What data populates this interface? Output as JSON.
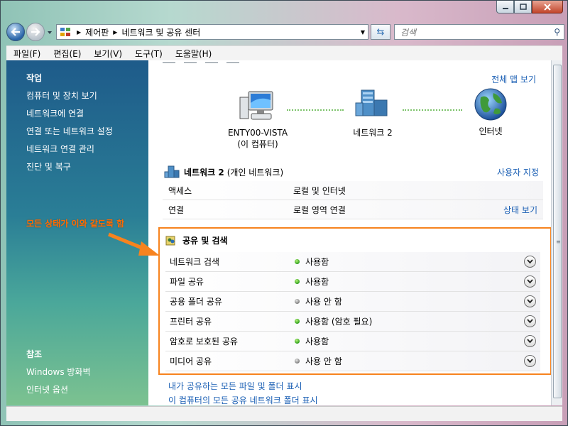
{
  "address": {
    "crumbs": [
      "제어판",
      "네트워크 및 공유 센터"
    ],
    "search_placeholder": "검색"
  },
  "menu": [
    "파일(F)",
    "편집(E)",
    "보기(V)",
    "도구(T)",
    "도움말(H)"
  ],
  "sidebar": {
    "tasks_heading": "작업",
    "tasks": [
      "컴퓨터 및 장치 보기",
      "네트워크에 연결",
      "연결 또는 네트워크 설정",
      "네트워크 연결 관리",
      "진단 및 복구"
    ],
    "see_also_heading": "참조",
    "see_also": [
      "Windows 방화벽",
      "인터넷 옵션"
    ]
  },
  "annotation": "모든 상태가 이와 같도록 함",
  "map": {
    "full_map_link": "전체 맵 보기",
    "computer_name": "ENTY00-VISTA",
    "computer_sub": "(이 컴퓨터)",
    "network_name": "네트워크  2",
    "internet_name": "인터넷"
  },
  "network": {
    "name": "네트워크  2",
    "type": "(개인 네트워크)",
    "customize": "사용자 지정",
    "rows": [
      {
        "label": "액세스",
        "value": "로컬 및 인터넷",
        "action": ""
      },
      {
        "label": "연결",
        "value": "로컬 영역 연결",
        "action": "상태 보기"
      }
    ]
  },
  "sharing": {
    "title": "공유 및 검색",
    "rows": [
      {
        "label": "네트워크 검색",
        "status": "사용함",
        "on": true
      },
      {
        "label": "파일 공유",
        "status": "사용함",
        "on": true
      },
      {
        "label": "공용 폴더 공유",
        "status": "사용 안 함",
        "on": false
      },
      {
        "label": "프린터 공유",
        "status": "사용함 (암호 필요)",
        "on": true
      },
      {
        "label": "암호로 보호된 공유",
        "status": "사용함",
        "on": true
      },
      {
        "label": "미디어 공유",
        "status": "사용 안 함",
        "on": false
      }
    ]
  },
  "bottom_links": [
    "내가 공유하는 모든 파일 및 폴더 표시",
    "이 컴퓨터의 모든 공유 네트워크 폴더 표시"
  ],
  "colors": {
    "accent": "#f7831e",
    "link": "#1a5fb4",
    "status_on": "#2c9e1a",
    "status_off": "#7d7d7d"
  }
}
